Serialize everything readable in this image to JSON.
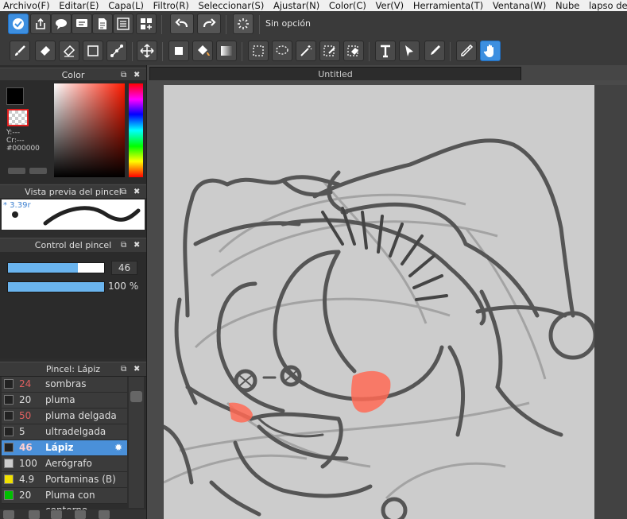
{
  "menu": [
    "Archivo(F)",
    "Editar(E)",
    "Capa(L)",
    "Filtro(R)",
    "Seleccionar(S)",
    "Ajustar(N)",
    "Color(C)",
    "Ver(V)",
    "Herramienta(T)",
    "Ventana(W)",
    "Nube",
    "lapso de"
  ],
  "toolbar": {
    "selection_option": "Sin opción"
  },
  "color_panel": {
    "title": "Color",
    "y_label": "Y:---",
    "cr_label": "Cr:---",
    "hex": "#000000"
  },
  "brush_preview": {
    "title": "Vista previa del pincel",
    "size": "* 3.39r"
  },
  "brush_control": {
    "title": "Control del pincel",
    "size_value": "46",
    "opacity_value": "100 %",
    "size_fraction": 0.73,
    "opacity_fraction": 1.0
  },
  "brush_panel": {
    "title": "Pincel: Lápiz",
    "items": [
      {
        "num": "24",
        "name": "sombras",
        "color": "#e06060",
        "swatch": "#222222"
      },
      {
        "num": "20",
        "name": "pluma",
        "color": "#dddddd",
        "swatch": "#222222"
      },
      {
        "num": "50",
        "name": "pluma delgada",
        "color": "#e06060",
        "swatch": "#222222"
      },
      {
        "num": "5",
        "name": "ultradelgada",
        "color": "#dddddd",
        "swatch": "#222222"
      },
      {
        "num": "46",
        "name": "Lápiz",
        "color": "#e06060",
        "swatch": "#222222",
        "selected": true
      },
      {
        "num": "100",
        "name": "Aerógrafo",
        "color": "#dddddd",
        "swatch": "#cccccc"
      },
      {
        "num": "4.9",
        "name": "Portaminas (B)",
        "color": "#dddddd",
        "swatch": "#f0e000"
      },
      {
        "num": "20",
        "name": "Pluma con contorno",
        "color": "#dddddd",
        "swatch": "#00c000"
      }
    ]
  },
  "document": {
    "tab_title": "Untitled"
  },
  "colors": {
    "accent": "#3d8fe0",
    "canvas_bg": "#cccccc",
    "blush": "#ff6a55"
  }
}
